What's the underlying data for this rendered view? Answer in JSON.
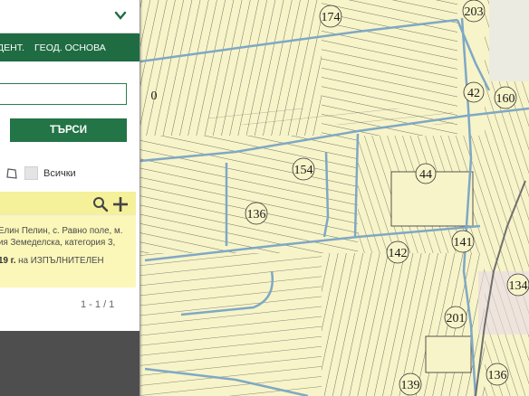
{
  "panel": {
    "tabs": [
      "ДЕНТ.",
      "ГЕОД. ОСНОВА"
    ],
    "search_button": "ТЪРСИ",
    "filter_all": "Всички",
    "result": {
      "line1": "Елин Пелин, с. Равно поле, м.",
      "line2": "ия Земеделска, категория 3,",
      "line3_prefix": "19 г.",
      "line3_rest": " на ИЗПЪЛНИТЕЛЕН"
    },
    "pager": "1 - 1 / 1"
  },
  "map": {
    "colors": {
      "parcel_fill": "#f7f4c9",
      "parcel_line": "#2f2f2f",
      "road": "#7fa8c4",
      "highway": "#6f6f6f"
    },
    "labels": [
      "174",
      "203",
      "42",
      "160",
      "0",
      "154",
      "44",
      "136",
      "141",
      "142",
      "134",
      "201",
      "139",
      "136"
    ]
  }
}
